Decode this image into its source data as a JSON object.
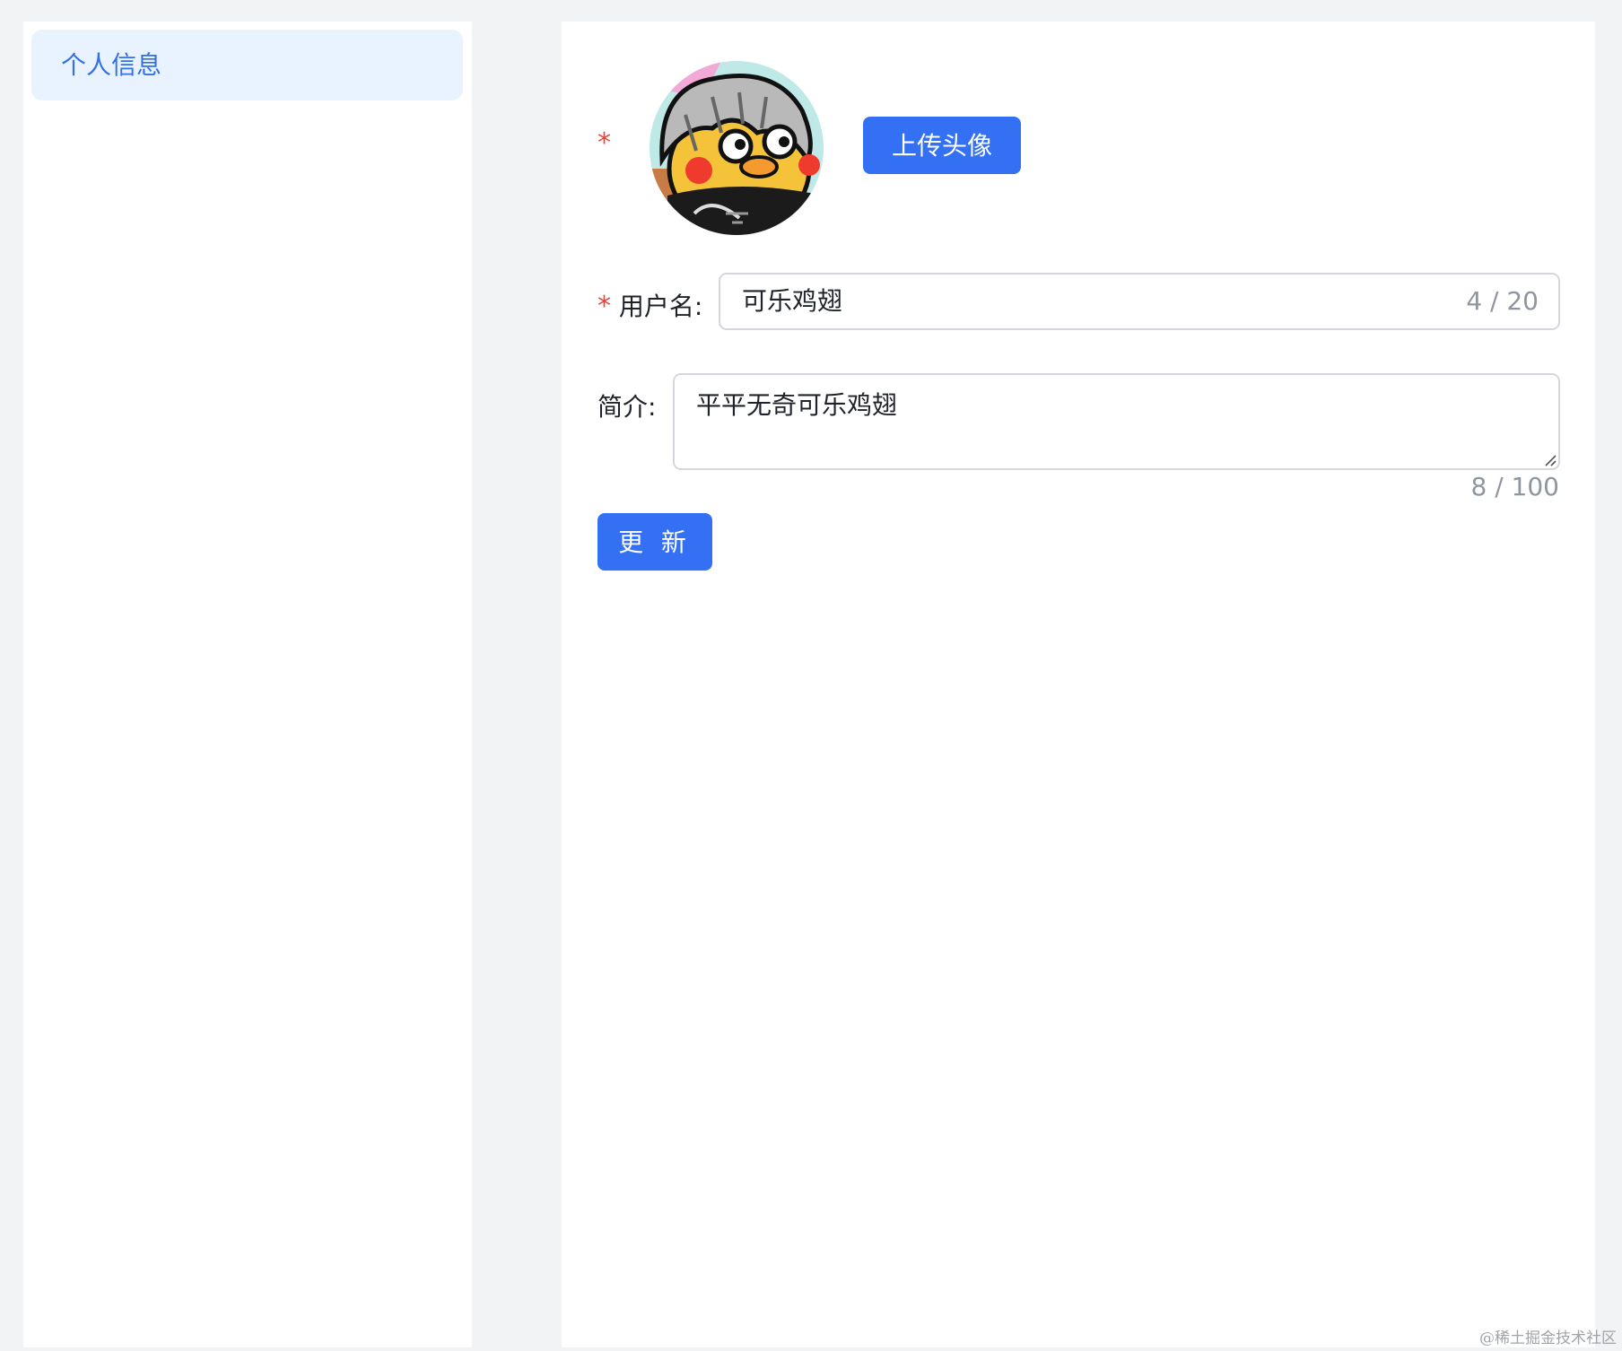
{
  "sidebar": {
    "items": [
      {
        "label": "个人信息",
        "active": true
      }
    ]
  },
  "profile": {
    "avatar": {
      "required_mark": "*",
      "upload_label": "上传头像"
    },
    "username": {
      "required_mark": "*",
      "label": "用户名:",
      "value": "可乐鸡翅",
      "count": "4 / 20"
    },
    "bio": {
      "label": "简介:",
      "value": "平平无奇可乐鸡翅",
      "count": "8 / 100"
    },
    "update_label": "更 新"
  },
  "watermark": "@稀土掘金技术社区",
  "colors": {
    "primary": "#3370f4",
    "menu_active_bg": "#e8f3ff",
    "menu_active_text": "#3370e8",
    "required": "#e5463c",
    "muted": "#8f959e",
    "page_bg": "#f2f3f5"
  }
}
